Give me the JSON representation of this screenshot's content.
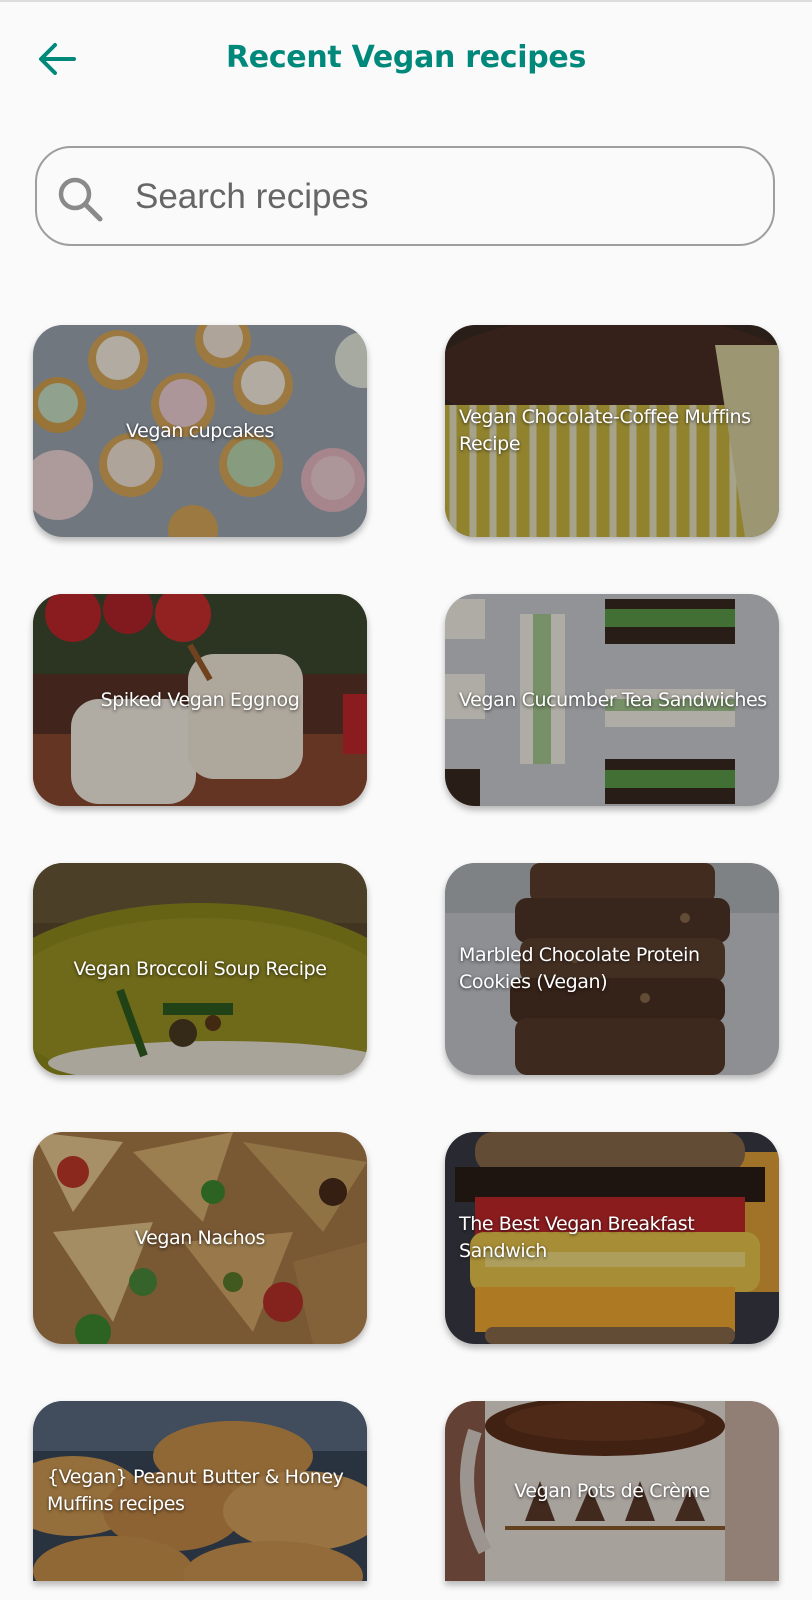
{
  "header": {
    "title": "Recent Vegan recipes",
    "back_icon": "arrow-left-icon",
    "accent_color": "#00897b"
  },
  "search": {
    "placeholder": "Search recipes",
    "value": "",
    "icon": "search-icon"
  },
  "recipes": [
    {
      "title": "Vegan cupcakes"
    },
    {
      "title": "Vegan Chocolate-Coffee Muffins Recipe"
    },
    {
      "title": "Spiked Vegan Eggnog"
    },
    {
      "title": "Vegan Cucumber Tea Sandwiches"
    },
    {
      "title": "Vegan Broccoli Soup Recipe"
    },
    {
      "title": "Marbled Chocolate Protein Cookies (Vegan)"
    },
    {
      "title": "Vegan Nachos"
    },
    {
      "title": "The Best Vegan Breakfast Sandwich"
    },
    {
      "title": "{Vegan} Peanut Butter & Honey Muffins recipes"
    },
    {
      "title": "Vegan Pots de Crème"
    }
  ]
}
